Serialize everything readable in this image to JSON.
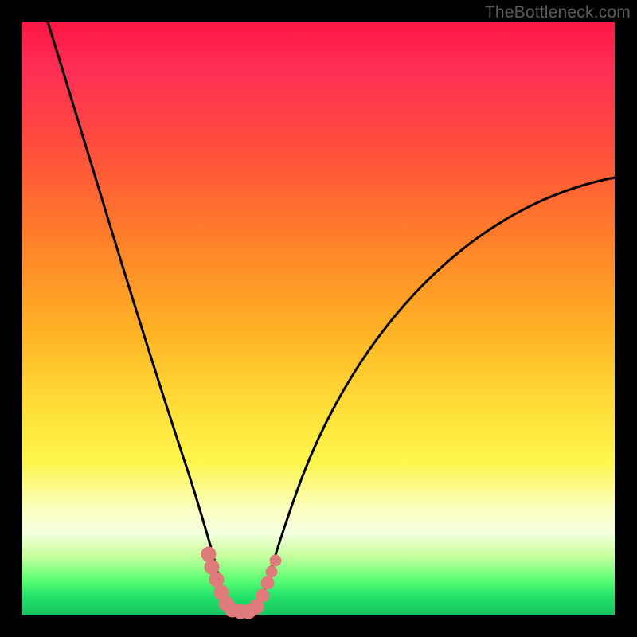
{
  "watermark": "TheBottleneck.com",
  "colors": {
    "frame": "#000000",
    "curve": "#000000",
    "marker": "#e07b7b",
    "gradient_stops": [
      "#ff1744",
      "#ff2e55",
      "#ff4a3e",
      "#ff7a2a",
      "#ffb224",
      "#ffe13a",
      "#fff54a",
      "#fbffbe",
      "#f6ffe0",
      "#c9ff9e",
      "#5eff73",
      "#22e06a",
      "#18c45e"
    ]
  },
  "chart_data": {
    "type": "line",
    "title": "",
    "xlabel": "",
    "ylabel": "",
    "xlim": [
      0,
      100
    ],
    "ylim": [
      0,
      100
    ],
    "series": [
      {
        "name": "bottleneck-curve",
        "x": [
          4,
          6,
          8,
          10,
          12,
          14,
          16,
          18,
          20,
          22,
          24,
          26,
          28,
          30,
          31,
          32,
          33,
          34,
          35,
          36,
          37,
          38,
          39,
          40,
          42,
          45,
          50,
          55,
          60,
          65,
          70,
          75,
          80,
          85,
          90,
          95,
          100
        ],
        "y": [
          100,
          94,
          87,
          80,
          73,
          66,
          59,
          52,
          45,
          38,
          31,
          24,
          17,
          10,
          6,
          3,
          1.5,
          0.8,
          0.4,
          0.3,
          0.3,
          0.5,
          1,
          2,
          5,
          9,
          17,
          25,
          32,
          39,
          45,
          51,
          56,
          61,
          65,
          69,
          72
        ]
      }
    ],
    "markers": {
      "name": "highlight-points",
      "x": [
        30.5,
        31,
        32,
        33,
        34,
        35,
        36,
        37,
        38.5,
        39.5,
        40
      ],
      "y": [
        6,
        4,
        2,
        1,
        0.6,
        0.4,
        0.3,
        0.4,
        1.5,
        3,
        5
      ]
    },
    "annotations": []
  }
}
